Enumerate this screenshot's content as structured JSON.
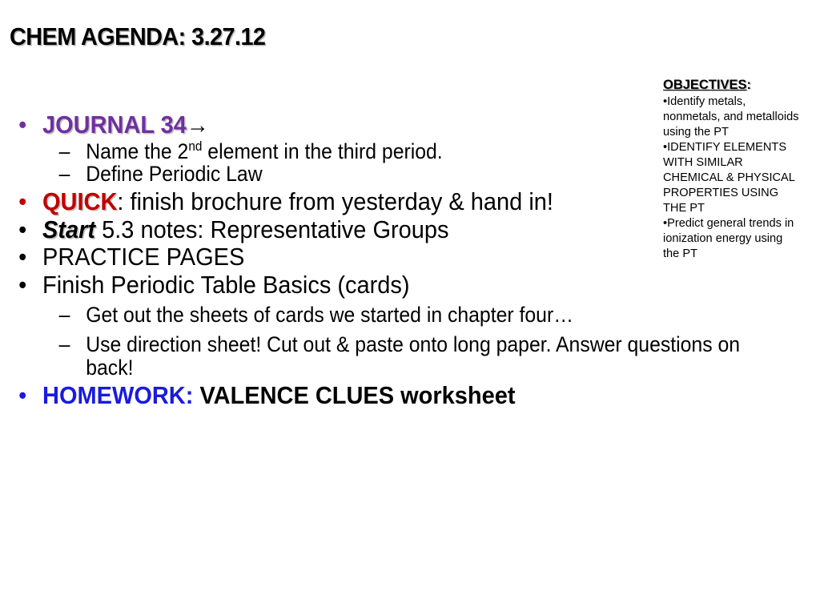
{
  "slide": {
    "title": "CHEM AGENDA: 3.27.12"
  },
  "agenda": {
    "bullet_glyph": "•",
    "dash_glyph": "–",
    "arrow_glyph": "→",
    "items": [
      {
        "level": 1,
        "emphasis_text": "JOURNAL 34",
        "emphasis_style": "purple-bold",
        "trailing_text": "",
        "arrow": true
      },
      {
        "level": 2,
        "text_before_sup": "Name the 2",
        "sup": "nd",
        "text_after_sup": " element in the third period."
      },
      {
        "level": 2,
        "text": "Define Periodic Law"
      },
      {
        "level": 1,
        "emphasis_text": "QUICK",
        "emphasis_style": "red-bold",
        "trailing_text": ": finish brochure from yesterday & hand in!"
      },
      {
        "level": 1,
        "emphasis_text": "Start",
        "emphasis_style": "black-bold-italic",
        "trailing_text": " 5.3 notes: Representative Groups"
      },
      {
        "level": 1,
        "text": "PRACTICE PAGES"
      },
      {
        "level": 1,
        "text": "Finish Periodic Table Basics (cards)"
      },
      {
        "level": 2,
        "text": "Get out the sheets of cards we started in chapter four…"
      },
      {
        "level": 2,
        "text": "Use direction sheet!  Cut out & paste onto long paper.  Answer questions on back!"
      },
      {
        "level": 1,
        "emphasis_text": "HOMEWORK:",
        "emphasis_style": "blue-bold",
        "trailing_text": " VALENCE CLUES worksheet"
      }
    ],
    "item_0_label": "JOURNAL 34",
    "item_1_label": "Name the 2nd element in the third period.",
    "item_2_label": "Define Periodic Law",
    "item_3_emph": "QUICK",
    "item_3_rest": ": finish brochure from yesterday & hand in!",
    "item_4_emph": "Start",
    "item_4_rest": " 5.3 notes: Representative Groups",
    "item_5_label": "PRACTICE PAGES",
    "item_6_label": "Finish Periodic Table Basics (cards)",
    "item_7_label": "Get out the sheets of cards we started in chapter four…",
    "item_8_label": "Use direction sheet!  Cut out & paste onto long paper.  Answer questions on back!",
    "item_9_emph": "HOMEWORK:",
    "item_9_rest": " VALENCE CLUES worksheet",
    "sub_name_pre": "Name the 2",
    "sub_name_sup": "nd",
    "sub_name_post": " element in the third period."
  },
  "objectives": {
    "heading": "OBJECTIVES",
    "heading_colon": ":",
    "bullet_glyph": "•",
    "items": [
      "Identify metals, nonmetals, and metalloids using the PT",
      "IDENTIFY ELEMENTS WITH SIMILAR CHEMICAL & PHYSICAL PROPERTIES USING THE PT",
      "Predict general trends in ionization energy using the PT"
    ],
    "item_0": "Identify metals, nonmetals, and metalloids using the PT",
    "item_1": "IDENTIFY ELEMENTS WITH SIMILAR CHEMICAL & PHYSICAL PROPERTIES USING THE PT",
    "item_2": "Predict general trends in ionization energy using the PT"
  },
  "colors": {
    "purple": "#7030A0",
    "red": "#C00000",
    "blue": "#1A1AE0",
    "black": "#000000",
    "background": "#FFFFFF"
  }
}
